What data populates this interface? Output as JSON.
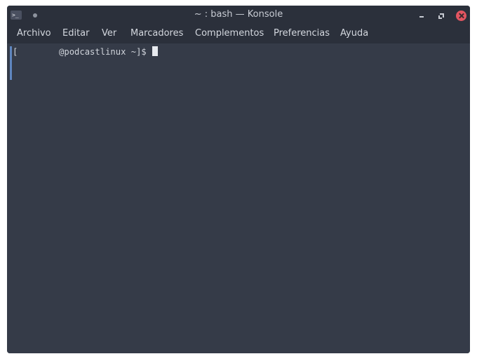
{
  "window": {
    "title": "~ : bash — Konsole",
    "app_icon_glyph": ">_"
  },
  "menubar": {
    "items": [
      {
        "label": "Archivo"
      },
      {
        "label": "Editar"
      },
      {
        "label": "Ver"
      },
      {
        "label": "Marcadores"
      },
      {
        "label": "Complementos"
      },
      {
        "label": "Preferencias"
      },
      {
        "label": "Ayuda"
      }
    ]
  },
  "terminal": {
    "prompt": "[        @podcastlinux ~]$ "
  },
  "icons": {
    "app": "konsole-icon",
    "pin": "pin-dot-icon",
    "minimize": "minimize-icon",
    "maximize": "maximize-icon",
    "close": "close-icon"
  },
  "colors": {
    "terminal_bg": "#353b48",
    "titlebar_bg": "#2b303b",
    "close_button": "#e35561",
    "scroll_marker": "#5f86bf"
  }
}
